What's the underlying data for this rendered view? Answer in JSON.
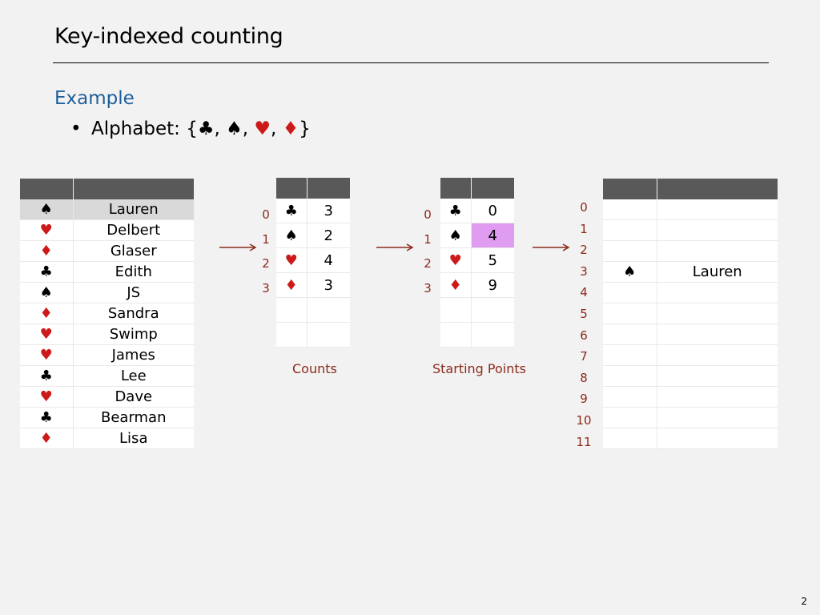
{
  "slide": {
    "title": "Key-indexed counting",
    "subtitle": "Example",
    "bullet_prefix": "Alphabet: {",
    "bullet_suffix": "}",
    "alphabet": [
      "♣",
      "♠",
      "♥",
      "♦"
    ],
    "page_number": "2"
  },
  "input_rows": [
    {
      "suit": "♠",
      "name": "Lauren"
    },
    {
      "suit": "♥",
      "name": "Delbert"
    },
    {
      "suit": "♦",
      "name": "Glaser"
    },
    {
      "suit": "♣",
      "name": "Edith"
    },
    {
      "suit": "♠",
      "name": "JS"
    },
    {
      "suit": "♦",
      "name": "Sandra"
    },
    {
      "suit": "♥",
      "name": "Swimp"
    },
    {
      "suit": "♥",
      "name": "James"
    },
    {
      "suit": "♣",
      "name": "Lee"
    },
    {
      "suit": "♥",
      "name": "Dave"
    },
    {
      "suit": "♣",
      "name": "Bearman"
    },
    {
      "suit": "♦",
      "name": "Lisa"
    }
  ],
  "counts": {
    "caption": "Counts",
    "indices": [
      "0",
      "1",
      "2",
      "3"
    ],
    "rows": [
      {
        "suit": "♣",
        "value": "3"
      },
      {
        "suit": "♠",
        "value": "2"
      },
      {
        "suit": "♥",
        "value": "4"
      },
      {
        "suit": "♦",
        "value": "3"
      }
    ]
  },
  "starting_points": {
    "caption": "Starting Points",
    "indices": [
      "0",
      "1",
      "2",
      "3"
    ],
    "rows": [
      {
        "suit": "♣",
        "value": "0"
      },
      {
        "suit": "♠",
        "value": "4"
      },
      {
        "suit": "♥",
        "value": "5"
      },
      {
        "suit": "♦",
        "value": "9"
      }
    ]
  },
  "aux": {
    "indices": [
      "0",
      "1",
      "2",
      "3",
      "4",
      "5",
      "6",
      "7",
      "8",
      "9",
      "10",
      "11"
    ],
    "filled": {
      "suit": "♠",
      "name": "Lauren"
    }
  },
  "colors": {
    "header": "#595959",
    "red_suit": "#cc1a1a",
    "index_label": "#8b2a1a",
    "highlight_pink": "#e09cf0",
    "highlight_grey": "#d9d9d9",
    "subtitle": "#1f5f9a"
  }
}
